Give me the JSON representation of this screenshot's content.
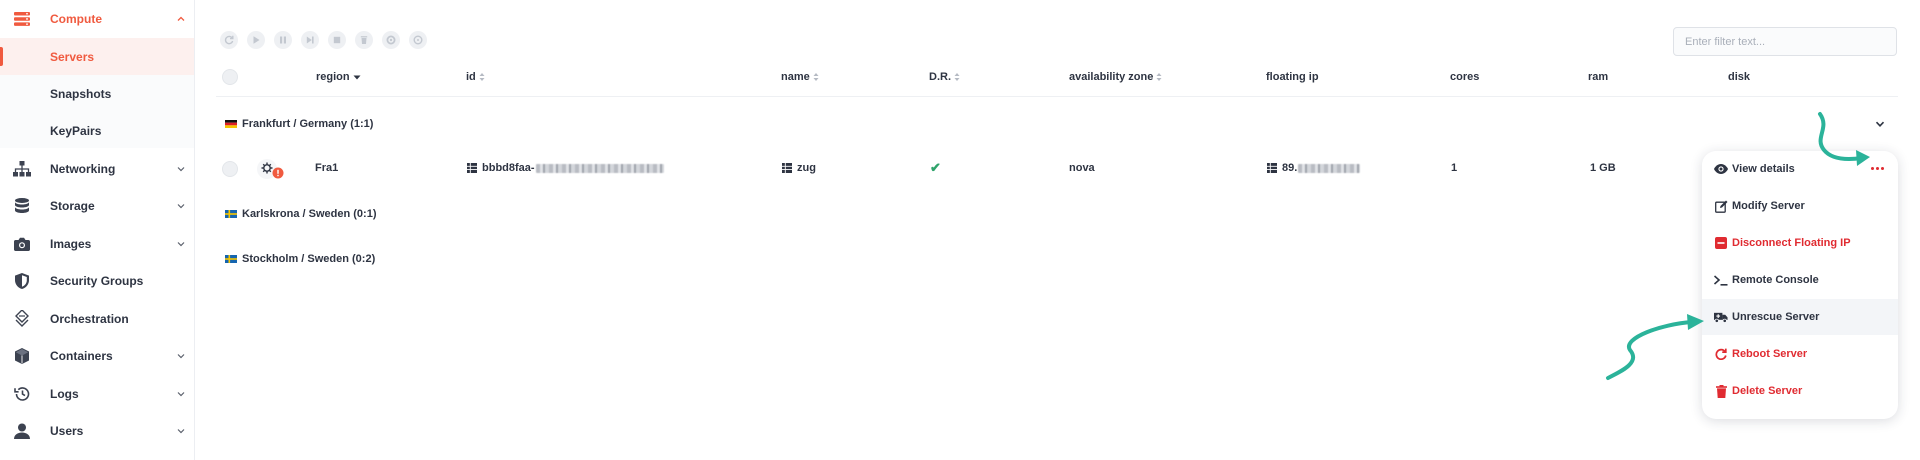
{
  "sidebar": {
    "items": [
      {
        "label": "Compute",
        "icon": "server-stack-icon",
        "expanded": true
      },
      {
        "label": "Servers"
      },
      {
        "label": "Snapshots"
      },
      {
        "label": "KeyPairs"
      },
      {
        "label": "Networking",
        "icon": "network-tree-icon"
      },
      {
        "label": "Storage",
        "icon": "database-icon"
      },
      {
        "label": "Images",
        "icon": "camera-icon"
      },
      {
        "label": "Security Groups",
        "icon": "shield-icon"
      },
      {
        "label": "Orchestration",
        "icon": "orchestration-icon"
      },
      {
        "label": "Containers",
        "icon": "cube-icon"
      },
      {
        "label": "Logs",
        "icon": "history-icon"
      },
      {
        "label": "Users",
        "icon": "user-icon"
      }
    ]
  },
  "toolbar": {
    "actions": [
      "refresh-icon",
      "play-icon",
      "pause-icon",
      "step-forward-icon",
      "stop-icon",
      "trash-icon",
      "rescue-icon",
      "more-circle-icon"
    ]
  },
  "filter": {
    "placeholder": "Enter filter text..."
  },
  "table": {
    "columns": [
      "region",
      "id",
      "name",
      "D.R.",
      "availability zone",
      "floating ip",
      "cores",
      "ram",
      "disk"
    ],
    "groups": [
      {
        "label": "Frankfurt / Germany (1:1)",
        "flag": "de"
      },
      {
        "label": "Karlskrona / Sweden (0:1)",
        "flag": "se"
      },
      {
        "label": "Stockholm / Sweden (0:2)",
        "flag": "se"
      }
    ],
    "row": {
      "region": "Fra1",
      "id": "bbbd8faa-",
      "name": "zug",
      "dr": "✔",
      "availability_zone": "nova",
      "floating_ip": "89.",
      "cores": "1",
      "ram": "1 GB"
    }
  },
  "menu": {
    "items": [
      {
        "label": "View details",
        "icon": "eye-icon"
      },
      {
        "label": "Modify Server",
        "icon": "edit-icon"
      },
      {
        "label": "Disconnect Floating IP",
        "icon": "minus-square-icon"
      },
      {
        "label": "Remote Console",
        "icon": "terminal-icon"
      },
      {
        "label": "Unrescue Server",
        "icon": "ambulance-icon"
      },
      {
        "label": "Reboot Server",
        "icon": "reboot-icon"
      },
      {
        "label": "Delete Server",
        "icon": "trash-icon"
      }
    ]
  },
  "colors": {
    "accent": "#f05a3f",
    "danger": "#e02b31",
    "success": "#2fa36b",
    "annotation": "#2bb39a"
  }
}
